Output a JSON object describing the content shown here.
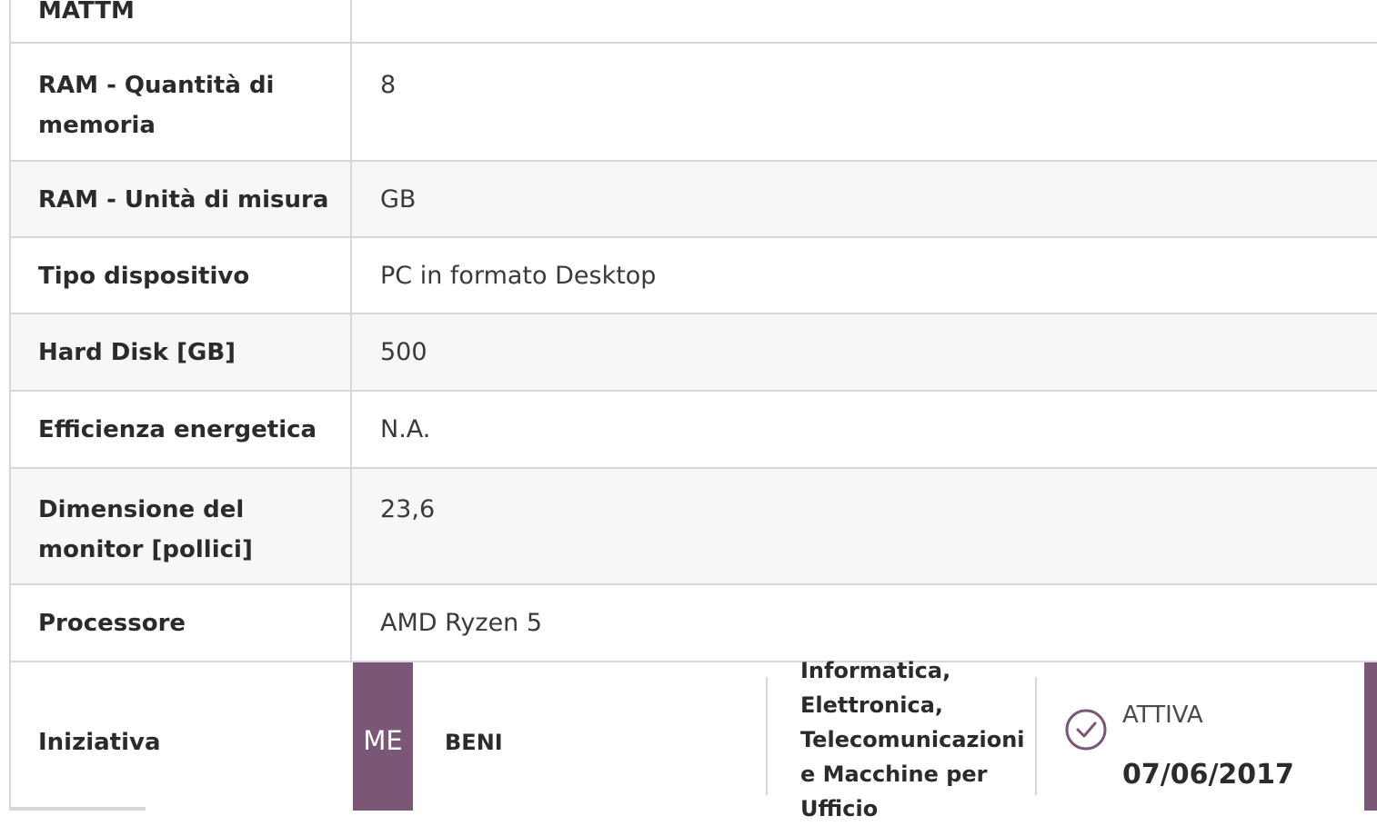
{
  "rows": [
    {
      "label": "MATTM",
      "value": ""
    },
    {
      "label": "RAM - Quantità di memoria",
      "value": "8"
    },
    {
      "label": "RAM - Unità di misura",
      "value": "GB"
    },
    {
      "label": "Tipo dispositivo",
      "value": "PC in formato Desktop"
    },
    {
      "label": "Hard Disk [GB]",
      "value": "500"
    },
    {
      "label": "Efficienza energetica",
      "value": "N.A."
    },
    {
      "label": "Dimensione del monitor [pollici]",
      "value": "23,6"
    },
    {
      "label": "Processore",
      "value": "AMD Ryzen 5"
    }
  ],
  "iniziativa": {
    "label": "Iniziativa",
    "badge": "ME",
    "type": "BENI",
    "category": "Informatica, Elettronica, Telecomunicazioni e Macchine per Ufficio",
    "status": "ATTIVA",
    "date": "07/06/2017",
    "status_icon": "check-circle-icon",
    "accent_color": "#7a5677"
  }
}
